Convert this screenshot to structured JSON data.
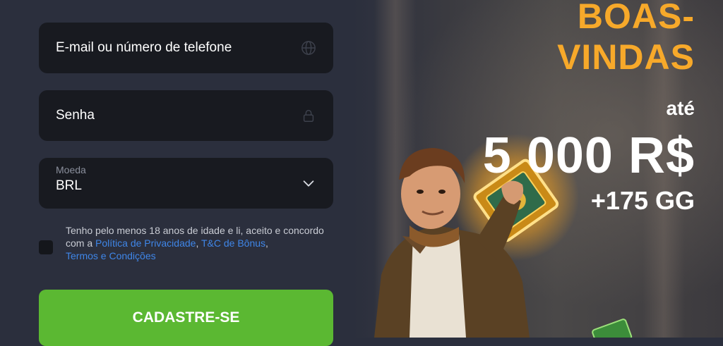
{
  "form": {
    "email_placeholder": "E-mail ou número de telefone",
    "password_placeholder": "Senha",
    "currency_label": "Moeda",
    "currency_value": "BRL",
    "terms_prefix": "Tenho pelo menos 18 anos de idade e li, aceito e concordo com a ",
    "privacy_link": "Política de Privacidade",
    "comma": ", ",
    "bonus_terms_link": "T&C de Bônus",
    "comma2": ",",
    "terms_link": "Termos e Condições",
    "submit_label": "CADASTRE-SE"
  },
  "promo": {
    "line1": "BOAS-",
    "line2": "VINDAS",
    "line3": "até",
    "amount": "5 000 R$",
    "bonus": "+175 GG"
  },
  "colors": {
    "accent_green": "#5bb832",
    "gold": "#f7a92a",
    "link_blue": "#3f86e8"
  },
  "icons": {
    "email": "globe-icon",
    "password": "lock-icon",
    "currency": "chevron-down-icon"
  }
}
